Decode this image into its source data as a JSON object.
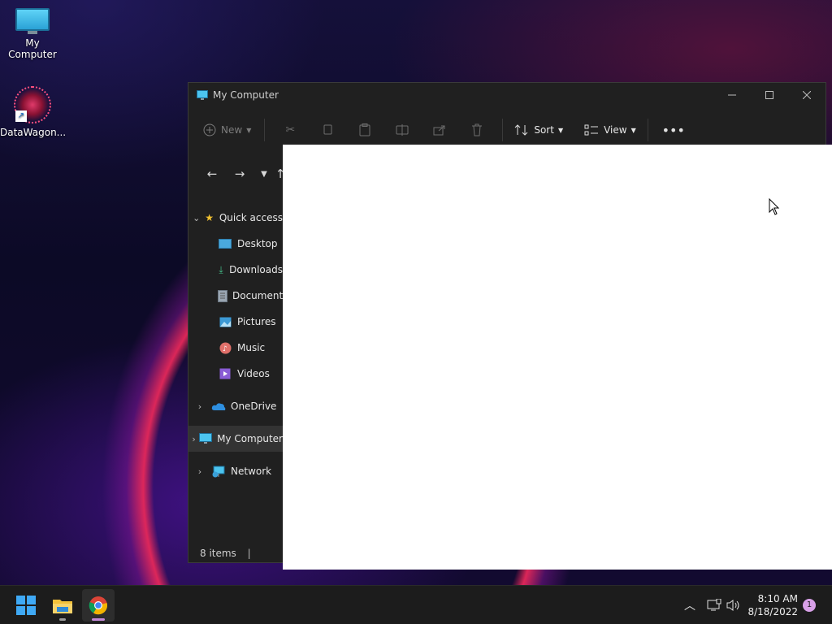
{
  "desktop": {
    "icons": [
      {
        "label": "My Computer"
      },
      {
        "label": "DataWagon..."
      }
    ]
  },
  "window": {
    "title": "My Computer",
    "toolbar": {
      "new_label": "New",
      "sort_label": "Sort",
      "view_label": "View"
    },
    "sidebar": {
      "items": [
        {
          "label": "Quick access"
        },
        {
          "label": "Desktop"
        },
        {
          "label": "Downloads"
        },
        {
          "label": "Documents"
        },
        {
          "label": "Pictures"
        },
        {
          "label": "Music"
        },
        {
          "label": "Videos"
        },
        {
          "label": "OneDrive"
        },
        {
          "label": "My Computer"
        },
        {
          "label": "Network"
        }
      ]
    },
    "status": {
      "items_count": "8 items"
    }
  },
  "taskbar": {
    "time": "8:10 AM",
    "date": "8/18/2022",
    "notification_count": "1"
  },
  "colors": {
    "window_bg": "#202020",
    "taskbar_bg": "#1c1c1c",
    "accent": "#c489d8"
  }
}
